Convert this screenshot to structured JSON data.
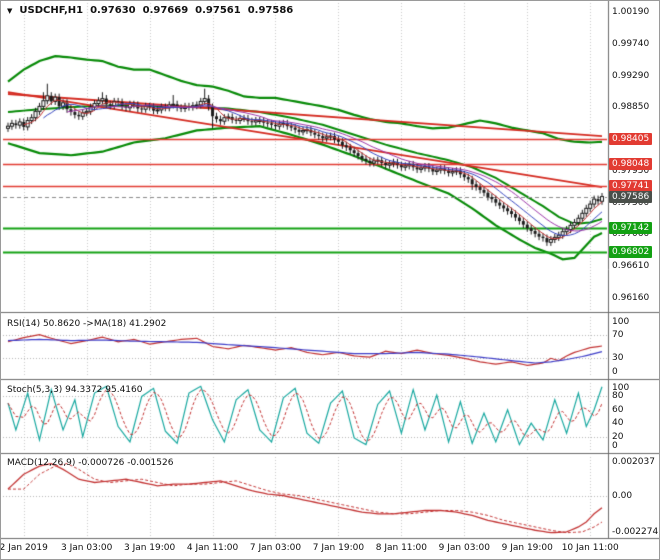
{
  "header": {
    "icon": "▼",
    "symbol_period": "USDCHF,H1",
    "open": "0.97630",
    "high": "0.97669",
    "low": "0.97561",
    "close": "0.97586"
  },
  "indicators": {
    "rsi": {
      "label": "RSI(14) 50.8620 ->MA(18) 41.2902"
    },
    "stoch": {
      "label": "Stoch(5,3,3) 94.3372 95.4160"
    },
    "macd": {
      "label": "MACD(12,26,9) -0.000726 -0.001526"
    }
  },
  "colors": {
    "resistance": "#e23b32",
    "support": "#13a113",
    "band": "#078a07",
    "trend": "#d42a20",
    "bull": "#ffffff",
    "bear": "#1c1c1c",
    "outline": "#1c1c1c",
    "rsi_main": "#c23232",
    "rsi_ma": "#3c3cc8",
    "stoch_main": "#18a8a0",
    "stoch_signal": "#c23232",
    "macd_main": "#c23232",
    "grid": "#c9c9c9",
    "level_grid": "#b5b5b5",
    "frame": "#6a6a6a",
    "current_badge": "#4a4f4a",
    "ma_fast": "#c23232",
    "ma_mid": "#3545c0",
    "ma_slow": "#9c35a8"
  },
  "chart_data": {
    "type": "candlestick",
    "symbol": "USDCHF",
    "timeframe": "H1",
    "price_scale": {
      "max": 1.0032,
      "min": 0.9597
    },
    "price_axis_labels": [
      "1.00190",
      "0.99740",
      "0.99290",
      "0.98850",
      "0.97950",
      "0.97500",
      "0.97060",
      "0.96610",
      "0.96160"
    ],
    "time_ticks": [
      {
        "index": 4,
        "label": "2 Jan 2019"
      },
      {
        "index": 20,
        "label": "3 Jan 03:00"
      },
      {
        "index": 36,
        "label": "3 Jan 19:00"
      },
      {
        "index": 52,
        "label": "4 Jan 11:00"
      },
      {
        "index": 68,
        "label": "7 Jan 03:00"
      },
      {
        "index": 84,
        "label": "7 Jan 19:00"
      },
      {
        "index": 100,
        "label": "8 Jan 11:00"
      },
      {
        "index": 116,
        "label": "9 Jan 03:00"
      },
      {
        "index": 132,
        "label": "9 Jan 19:00"
      },
      {
        "index": 148,
        "label": "10 Jan 11:00"
      }
    ],
    "levels": {
      "resistance": [
        {
          "price": 0.98405,
          "label": "0.98405"
        },
        {
          "price": 0.98048,
          "label": "0.98048"
        },
        {
          "price": 0.97741,
          "label": "0.97741"
        }
      ],
      "support": [
        {
          "price": 0.97142,
          "label": "0.97142"
        },
        {
          "price": 0.96802,
          "label": "0.96802"
        }
      ],
      "current": {
        "price": 0.97586,
        "label": "0.97586"
      }
    },
    "trendlines": [
      {
        "from": [
          0,
          0.99035
        ],
        "to": [
          151,
          0.9844
        ]
      },
      {
        "from": [
          0,
          0.9906
        ],
        "to": [
          151,
          0.9772
        ]
      }
    ],
    "bollinger": {
      "upper": [
        [
          0,
          0.9921
        ],
        [
          4,
          0.9938
        ],
        [
          8,
          0.995
        ],
        [
          12,
          0.9957
        ],
        [
          16,
          0.9955
        ],
        [
          20,
          0.9952
        ],
        [
          24,
          0.995
        ],
        [
          28,
          0.9942
        ],
        [
          32,
          0.9938
        ],
        [
          36,
          0.9938
        ],
        [
          40,
          0.993
        ],
        [
          44,
          0.9922
        ],
        [
          48,
          0.9916
        ],
        [
          52,
          0.9914
        ],
        [
          56,
          0.9908
        ],
        [
          60,
          0.99
        ],
        [
          64,
          0.9898
        ],
        [
          68,
          0.9898
        ],
        [
          72,
          0.9894
        ],
        [
          76,
          0.989
        ],
        [
          80,
          0.9886
        ],
        [
          84,
          0.9881
        ],
        [
          88,
          0.9874
        ],
        [
          92,
          0.9868
        ],
        [
          96,
          0.9864
        ],
        [
          100,
          0.9862
        ],
        [
          104,
          0.9858
        ],
        [
          108,
          0.9855
        ],
        [
          112,
          0.9856
        ],
        [
          116,
          0.9861
        ],
        [
          120,
          0.9866
        ],
        [
          124,
          0.9862
        ],
        [
          128,
          0.9856
        ],
        [
          132,
          0.9852
        ],
        [
          136,
          0.9848
        ],
        [
          140,
          0.984
        ],
        [
          144,
          0.9836
        ],
        [
          148,
          0.9835
        ],
        [
          151,
          0.9836
        ]
      ],
      "middle": [
        [
          0,
          0.9878
        ],
        [
          8,
          0.9882
        ],
        [
          16,
          0.9885
        ],
        [
          24,
          0.9887
        ],
        [
          32,
          0.9887
        ],
        [
          40,
          0.9886
        ],
        [
          48,
          0.9885
        ],
        [
          56,
          0.9883
        ],
        [
          64,
          0.9878
        ],
        [
          72,
          0.987
        ],
        [
          80,
          0.986
        ],
        [
          88,
          0.9846
        ],
        [
          96,
          0.9832
        ],
        [
          104,
          0.982
        ],
        [
          112,
          0.981
        ],
        [
          118,
          0.98
        ],
        [
          124,
          0.9785
        ],
        [
          130,
          0.9765
        ],
        [
          136,
          0.9745
        ],
        [
          140,
          0.973
        ],
        [
          144,
          0.972
        ],
        [
          148,
          0.9722
        ],
        [
          151,
          0.9727
        ]
      ],
      "lower": [
        [
          0,
          0.9834
        ],
        [
          8,
          0.982
        ],
        [
          16,
          0.9817
        ],
        [
          24,
          0.9822
        ],
        [
          32,
          0.9835
        ],
        [
          40,
          0.9841
        ],
        [
          48,
          0.9852
        ],
        [
          56,
          0.9856
        ],
        [
          64,
          0.9858
        ],
        [
          72,
          0.9846
        ],
        [
          80,
          0.9832
        ],
        [
          88,
          0.9816
        ],
        [
          96,
          0.9798
        ],
        [
          104,
          0.978
        ],
        [
          112,
          0.9763
        ],
        [
          118,
          0.9742
        ],
        [
          124,
          0.9718
        ],
        [
          130,
          0.9698
        ],
        [
          134,
          0.9686
        ],
        [
          138,
          0.9678
        ],
        [
          141,
          0.967
        ],
        [
          144,
          0.9672
        ],
        [
          147,
          0.969
        ],
        [
          149,
          0.9702
        ],
        [
          151,
          0.9707
        ]
      ]
    },
    "candles": {
      "first_open": 0.9855,
      "wick": 0.0005,
      "closes": [
        0.9858,
        0.9862,
        0.98595,
        0.9864,
        0.9857,
        0.9866,
        0.987,
        0.9879,
        0.9886,
        0.9894,
        0.9901,
        0.9893,
        0.9899,
        0.9886,
        0.9891,
        0.9882,
        0.9878,
        0.9874,
        0.9872,
        0.9877,
        0.9879,
        0.9885,
        0.989,
        0.9894,
        0.9897,
        0.9889,
        0.9887,
        0.9893,
        0.9892,
        0.9886,
        0.9884,
        0.9889,
        0.9888,
        0.9883,
        0.9882,
        0.9886,
        0.9885,
        0.988,
        0.9881,
        0.9885,
        0.9884,
        0.9888,
        0.9889,
        0.9884,
        0.9883,
        0.9886,
        0.9885,
        0.9887,
        0.9888,
        0.9893,
        0.9897,
        0.9885,
        0.9872,
        0.9868,
        0.9865,
        0.987,
        0.9871,
        0.9867,
        0.9866,
        0.9869,
        0.9869,
        0.9865,
        0.9864,
        0.9866,
        0.9866,
        0.9863,
        0.9862,
        0.986,
        0.9858,
        0.9861,
        0.9862,
        0.9858,
        0.9856,
        0.9853,
        0.985,
        0.9852,
        0.9853,
        0.9849,
        0.9846,
        0.9844,
        0.9841,
        0.9843,
        0.9844,
        0.9839,
        0.9836,
        0.9831,
        0.9828,
        0.9824,
        0.982,
        0.9816,
        0.9812,
        0.9809,
        0.9806,
        0.9809,
        0.981,
        0.9806,
        0.9803,
        0.9805,
        0.9807,
        0.9803,
        0.98,
        0.9802,
        0.9804,
        0.98,
        0.9797,
        0.9799,
        0.9801,
        0.9798,
        0.9794,
        0.9796,
        0.9798,
        0.9795,
        0.9792,
        0.9794,
        0.9795,
        0.979,
        0.9786,
        0.9783,
        0.9776,
        0.9772,
        0.9768,
        0.9764,
        0.9758,
        0.9755,
        0.975,
        0.9746,
        0.9742,
        0.9738,
        0.9734,
        0.9729,
        0.9724,
        0.9719,
        0.9714,
        0.971,
        0.9706,
        0.9702,
        0.97,
        0.9694,
        0.9698,
        0.9701,
        0.9704,
        0.9709,
        0.9712,
        0.9718,
        0.9722,
        0.9728,
        0.9735,
        0.9742,
        0.9748,
        0.9755,
        0.9752,
        0.97586
      ],
      "spikes": {
        "9": {
          "h": 0.9906
        },
        "10": {
          "h": 0.9918
        },
        "24": {
          "h": 0.9906
        },
        "42": {
          "h": 0.9902
        },
        "50": {
          "h": 0.9911
        },
        "52": {
          "l": 0.9855
        },
        "118": {
          "l": 0.9768
        },
        "137": {
          "l": 0.9689
        }
      }
    },
    "moving_average_periods": [
      5,
      10,
      16
    ],
    "rsi": {
      "value": 50.862,
      "ma_value": 41.2902,
      "axis": [
        {
          "text": "100",
          "value": 100
        },
        {
          "text": "70",
          "value": 70
        },
        {
          "text": "30",
          "value": 30
        },
        {
          "text": "0",
          "value": 0
        }
      ],
      "levels": [
        70,
        30
      ],
      "series": [
        [
          0,
          58
        ],
        [
          4,
          65
        ],
        [
          8,
          70
        ],
        [
          12,
          62
        ],
        [
          16,
          55
        ],
        [
          20,
          60
        ],
        [
          24,
          66
        ],
        [
          28,
          58
        ],
        [
          32,
          62
        ],
        [
          36,
          54
        ],
        [
          40,
          58
        ],
        [
          44,
          62
        ],
        [
          48,
          64
        ],
        [
          52,
          50
        ],
        [
          56,
          46
        ],
        [
          60,
          52
        ],
        [
          64,
          48
        ],
        [
          68,
          44
        ],
        [
          72,
          48
        ],
        [
          76,
          40
        ],
        [
          80,
          36
        ],
        [
          84,
          40
        ],
        [
          88,
          34
        ],
        [
          92,
          32
        ],
        [
          96,
          42
        ],
        [
          100,
          38
        ],
        [
          104,
          44
        ],
        [
          108,
          38
        ],
        [
          112,
          35
        ],
        [
          116,
          30
        ],
        [
          120,
          24
        ],
        [
          124,
          20
        ],
        [
          128,
          24
        ],
        [
          132,
          18
        ],
        [
          136,
          22
        ],
        [
          138,
          30
        ],
        [
          140,
          26
        ],
        [
          142,
          34
        ],
        [
          144,
          40
        ],
        [
          146,
          44
        ],
        [
          148,
          48
        ],
        [
          151,
          50.86
        ]
      ],
      "ma_series": [
        [
          0,
          60
        ],
        [
          8,
          62
        ],
        [
          16,
          60
        ],
        [
          24,
          61
        ],
        [
          32,
          59
        ],
        [
          40,
          58
        ],
        [
          48,
          57
        ],
        [
          56,
          53
        ],
        [
          64,
          50
        ],
        [
          72,
          46
        ],
        [
          80,
          42
        ],
        [
          88,
          38
        ],
        [
          96,
          38
        ],
        [
          104,
          40
        ],
        [
          112,
          37
        ],
        [
          120,
          32
        ],
        [
          128,
          26
        ],
        [
          134,
          22
        ],
        [
          138,
          24
        ],
        [
          142,
          28
        ],
        [
          146,
          33
        ],
        [
          151,
          41.29
        ]
      ]
    },
    "stoch": {
      "main_value": 94.3372,
      "signal_value": 95.416,
      "axis": [
        {
          "text": "100",
          "value": 100
        },
        {
          "text": "80",
          "value": 80
        },
        {
          "text": "60",
          "value": 60
        },
        {
          "text": "40",
          "value": 40
        },
        {
          "text": "20",
          "value": 20
        },
        {
          "text": "0",
          "value": 0
        }
      ],
      "levels": [
        80,
        20
      ],
      "series": [
        [
          0,
          70
        ],
        [
          2,
          30
        ],
        [
          5,
          85
        ],
        [
          8,
          15
        ],
        [
          11,
          90
        ],
        [
          14,
          30
        ],
        [
          17,
          75
        ],
        [
          19,
          20
        ],
        [
          22,
          85
        ],
        [
          25,
          95
        ],
        [
          28,
          35
        ],
        [
          31,
          12
        ],
        [
          34,
          80
        ],
        [
          37,
          92
        ],
        [
          40,
          28
        ],
        [
          43,
          10
        ],
        [
          46,
          85
        ],
        [
          49,
          95
        ],
        [
          52,
          45
        ],
        [
          55,
          12
        ],
        [
          58,
          75
        ],
        [
          61,
          90
        ],
        [
          64,
          30
        ],
        [
          67,
          12
        ],
        [
          70,
          78
        ],
        [
          73,
          92
        ],
        [
          76,
          25
        ],
        [
          79,
          10
        ],
        [
          82,
          70
        ],
        [
          85,
          88
        ],
        [
          88,
          18
        ],
        [
          91,
          8
        ],
        [
          94,
          68
        ],
        [
          97,
          88
        ],
        [
          100,
          25
        ],
        [
          103,
          90
        ],
        [
          106,
          30
        ],
        [
          109,
          82
        ],
        [
          112,
          12
        ],
        [
          115,
          72
        ],
        [
          118,
          10
        ],
        [
          121,
          55
        ],
        [
          124,
          12
        ],
        [
          127,
          60
        ],
        [
          130,
          8
        ],
        [
          133,
          40
        ],
        [
          136,
          15
        ],
        [
          139,
          75
        ],
        [
          142,
          25
        ],
        [
          145,
          85
        ],
        [
          147,
          35
        ],
        [
          149,
          60
        ],
        [
          151,
          94.34
        ]
      ]
    },
    "macd": {
      "main_value": -0.000726,
      "signal_value": -0.001526,
      "axis": [
        {
          "text": "0.002037",
          "value": 0.002037
        },
        {
          "text": "0.00",
          "value": 0
        },
        {
          "text": "-0.002274",
          "value": -0.002274
        }
      ],
      "range": {
        "max": 0.00235,
        "min": -0.00245
      },
      "series": [
        [
          0,
          0.0004
        ],
        [
          4,
          0.0013
        ],
        [
          8,
          0.0018
        ],
        [
          11,
          0.00195
        ],
        [
          14,
          0.0016
        ],
        [
          18,
          0.001
        ],
        [
          22,
          0.0008
        ],
        [
          26,
          0.0009
        ],
        [
          30,
          0.001
        ],
        [
          34,
          0.0008
        ],
        [
          38,
          0.0006
        ],
        [
          42,
          0.0007
        ],
        [
          46,
          0.0007
        ],
        [
          50,
          0.0008
        ],
        [
          54,
          0.0009
        ],
        [
          58,
          0.0006
        ],
        [
          62,
          0.0003
        ],
        [
          66,
          0.0001
        ],
        [
          70,
          0.0
        ],
        [
          74,
          -0.0002
        ],
        [
          78,
          -0.0004
        ],
        [
          82,
          -0.0006
        ],
        [
          86,
          -0.0008
        ],
        [
          90,
          -0.001
        ],
        [
          94,
          -0.0011
        ],
        [
          98,
          -0.0011
        ],
        [
          102,
          -0.001
        ],
        [
          106,
          -0.0009
        ],
        [
          110,
          -0.0009
        ],
        [
          114,
          -0.001
        ],
        [
          118,
          -0.0012
        ],
        [
          122,
          -0.0015
        ],
        [
          126,
          -0.0017
        ],
        [
          130,
          -0.0019
        ],
        [
          134,
          -0.0021
        ],
        [
          138,
          -0.00225
        ],
        [
          142,
          -0.0022
        ],
        [
          145,
          -0.0019
        ],
        [
          147,
          -0.0016
        ],
        [
          149,
          -0.0011
        ],
        [
          151,
          -0.00073
        ]
      ]
    }
  }
}
